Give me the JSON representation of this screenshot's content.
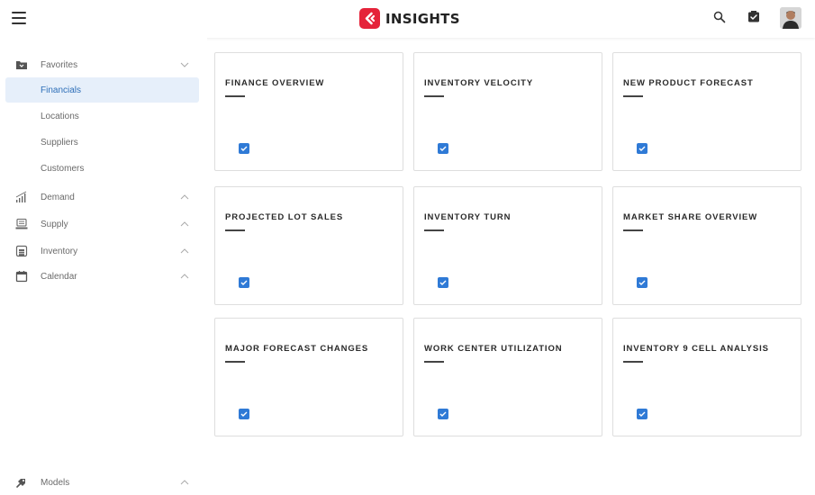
{
  "header": {
    "brand_name": "INSIGHTS",
    "icons": [
      "hamburger-icon",
      "search-icon",
      "tasks-icon",
      "user-avatar"
    ]
  },
  "sidebar": {
    "items": [
      {
        "label": "Favorites",
        "icon": "folder-icon",
        "expand": "chevron-down"
      },
      {
        "label": "Financials",
        "active": true
      },
      {
        "label": "Locations"
      },
      {
        "label": "Suppliers"
      },
      {
        "label": "Customers"
      },
      {
        "label": "Demand",
        "icon": "signal-icon",
        "expand": "chevron-up"
      },
      {
        "label": "Supply",
        "icon": "supply-icon",
        "expand": "chevron-up"
      },
      {
        "label": "Inventory",
        "icon": "warehouse-icon",
        "expand": "chevron-up"
      },
      {
        "label": "Calendar",
        "icon": "calendar-icon",
        "expand": "chevron-up"
      }
    ],
    "footer": {
      "label": "Models",
      "icon": "models-icon",
      "expand": "chevron-up"
    }
  },
  "cards": [
    {
      "title": "FINANCE OVERVIEW"
    },
    {
      "title": "INVENTORY VELOCITY"
    },
    {
      "title": "NEW PRODUCT FORECAST"
    },
    {
      "title": "PROJECTED LOT SALES"
    },
    {
      "title": "INVENTORY TURN"
    },
    {
      "title": "MARKET SHARE OVERVIEW"
    },
    {
      "title": "MAJOR FORECAST CHANGES"
    },
    {
      "title": "WORK CENTER UTILIZATION"
    },
    {
      "title": "INVENTORY 9 CELL ANALYSIS"
    }
  ],
  "colors": {
    "brand": "#e5233a",
    "active_bg": "#e6effa",
    "active_text": "#2e6fb8",
    "card_icon": "#2f7ad6"
  }
}
